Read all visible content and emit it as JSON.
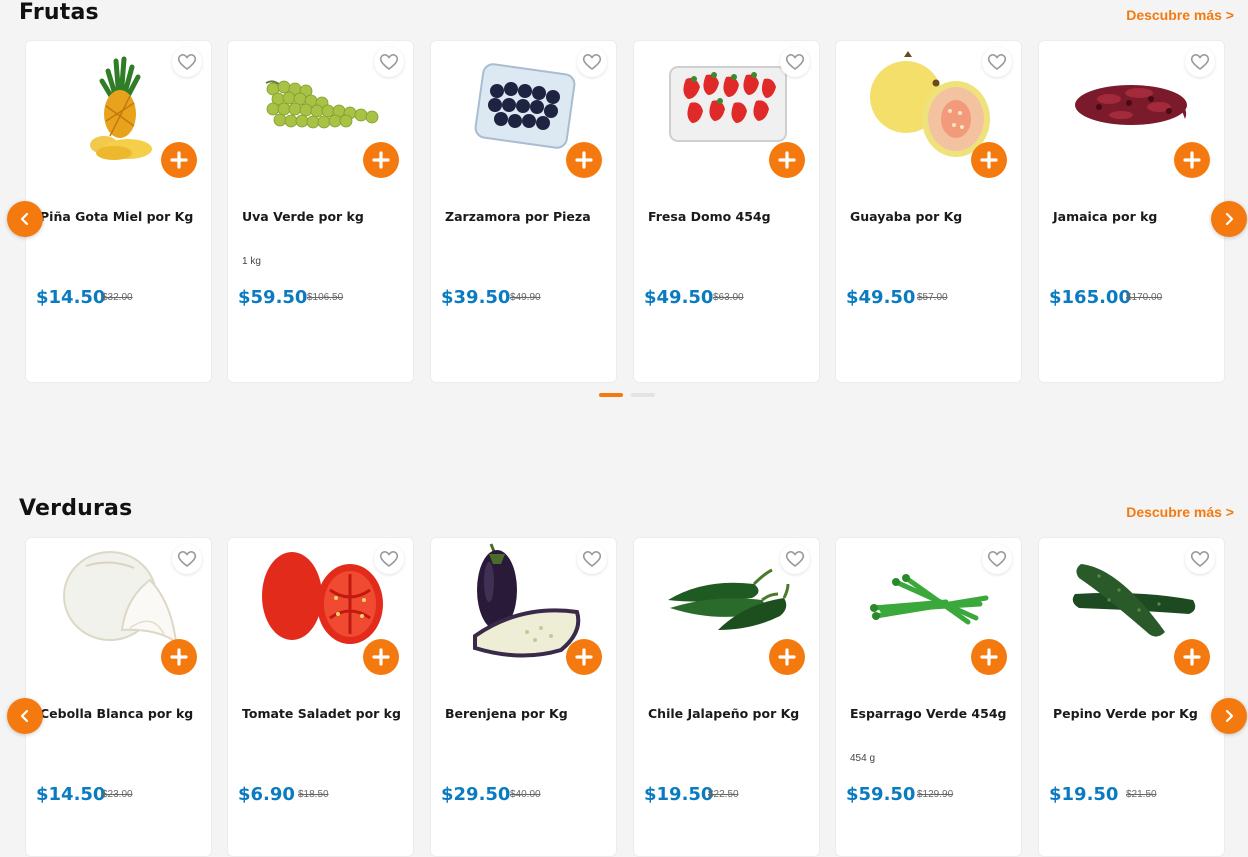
{
  "colors": {
    "accent": "#f47a0f",
    "price": "#0a7bc0",
    "background": "#f4f4f4"
  },
  "sections": [
    {
      "title": "Frutas",
      "link": "Descubre más >",
      "products": [
        {
          "name": "Piña Gota Miel por Kg",
          "unit": "",
          "price": "$14.50",
          "old_price": "$32.00"
        },
        {
          "name": "Uva Verde por kg",
          "unit": "1 kg",
          "price": "$59.50",
          "old_price": "$106.50"
        },
        {
          "name": "Zarzamora por Pieza",
          "unit": "",
          "price": "$39.50",
          "old_price": "$49.90"
        },
        {
          "name": "Fresa Domo 454g",
          "unit": "",
          "price": "$49.50",
          "old_price": "$63.00"
        },
        {
          "name": "Guayaba por Kg",
          "unit": "",
          "price": "$49.50",
          "old_price": "$57.00"
        },
        {
          "name": "Jamaica por kg",
          "unit": "",
          "price": "$165.00",
          "old_price": "$170.00"
        }
      ]
    },
    {
      "title": "Verduras",
      "link": "Descubre más >",
      "products": [
        {
          "name": "Cebolla Blanca por kg",
          "unit": "",
          "price": "$14.50",
          "old_price": "$23.00"
        },
        {
          "name": "Tomate Saladet por kg",
          "unit": "",
          "price": "$6.90",
          "old_price": "$18.50"
        },
        {
          "name": "Berenjena por Kg",
          "unit": "",
          "price": "$29.50",
          "old_price": "$40.00"
        },
        {
          "name": "Chile Jalapeño por Kg",
          "unit": "",
          "price": "$19.50",
          "old_price": "$22.50"
        },
        {
          "name": "Esparrago Verde 454g",
          "unit": "454 g",
          "price": "$59.50",
          "old_price": "$129.90"
        },
        {
          "name": "Pepino Verde por Kg",
          "unit": "",
          "price": "$19.50",
          "old_price": "$21.50"
        }
      ]
    }
  ],
  "icons": {
    "favorite": "heart-icon",
    "add": "plus-icon",
    "prev": "chevron-left-icon",
    "next": "chevron-right-icon"
  }
}
